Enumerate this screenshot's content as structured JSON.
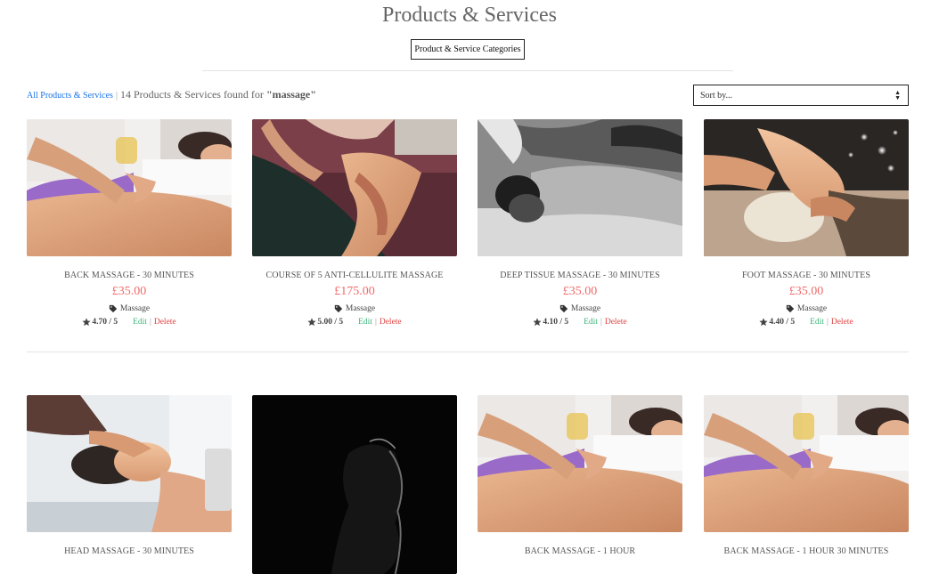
{
  "page": {
    "title": "Products & Services",
    "categories_button": "Product & Service Categories"
  },
  "results": {
    "all_link": "All Products & Services",
    "separator": "|",
    "count_text": "14 Products & Services found for",
    "query": "\"massage\""
  },
  "sort": {
    "placeholder": "Sort by..."
  },
  "products": [
    {
      "name": "BACK MASSAGE - 30 MINUTES",
      "price": "£35.00",
      "category": "Massage",
      "rating": "4.70 / 5",
      "edit": "Edit",
      "sep": "|",
      "delete": "Delete",
      "image": "oil-back-massage-photo"
    },
    {
      "name": "COURSE OF 5 ANTI-CELLULITE MASSAGE",
      "price": "£175.00",
      "category": "Massage",
      "rating": "5.00 / 5",
      "edit": "Edit",
      "sep": "|",
      "delete": "Delete",
      "image": "leg-massage-photo"
    },
    {
      "name": "DEEP TISSUE MASSAGE - 30 MINUTES",
      "price": "£35.00",
      "category": "Massage",
      "rating": "4.10 / 5",
      "edit": "Edit",
      "sep": "|",
      "delete": "Delete",
      "image": "bw-deep-tissue-photo"
    },
    {
      "name": "FOOT MASSAGE - 30 MINUTES",
      "price": "£35.00",
      "category": "Massage",
      "rating": "4.40 / 5",
      "edit": "Edit",
      "sep": "|",
      "delete": "Delete",
      "image": "foot-massage-photo"
    },
    {
      "name": "HEAD MASSAGE - 30 MINUTES",
      "image": "head-massage-photo"
    },
    {
      "name": "",
      "image": "dark-silhouette-photo"
    },
    {
      "name": "BACK MASSAGE - 1 HOUR",
      "image": "oil-back-massage-photo"
    },
    {
      "name": "BACK MASSAGE - 1 HOUR 30 MINUTES",
      "image": "oil-back-massage-photo"
    }
  ],
  "colors": {
    "price": "#f06a6a",
    "edit": "#3cb37a",
    "delete": "#e04040",
    "link": "#1a73e8"
  }
}
